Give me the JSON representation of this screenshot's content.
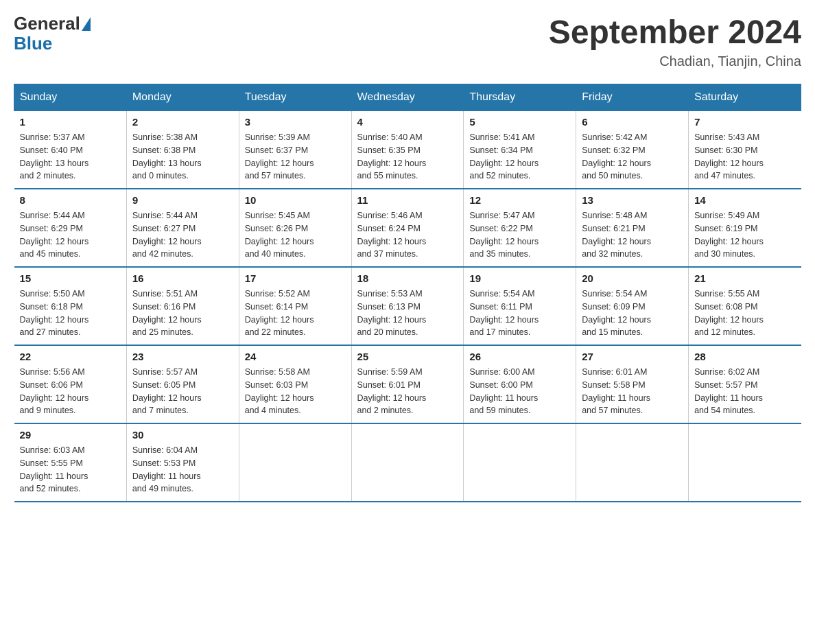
{
  "header": {
    "logo": {
      "text_general": "General",
      "text_blue": "Blue"
    },
    "title": "September 2024",
    "location": "Chadian, Tianjin, China"
  },
  "days_of_week": [
    "Sunday",
    "Monday",
    "Tuesday",
    "Wednesday",
    "Thursday",
    "Friday",
    "Saturday"
  ],
  "weeks": [
    [
      {
        "day": "1",
        "sunrise": "5:37 AM",
        "sunset": "6:40 PM",
        "daylight": "13 hours and 2 minutes."
      },
      {
        "day": "2",
        "sunrise": "5:38 AM",
        "sunset": "6:38 PM",
        "daylight": "13 hours and 0 minutes."
      },
      {
        "day": "3",
        "sunrise": "5:39 AM",
        "sunset": "6:37 PM",
        "daylight": "12 hours and 57 minutes."
      },
      {
        "day": "4",
        "sunrise": "5:40 AM",
        "sunset": "6:35 PM",
        "daylight": "12 hours and 55 minutes."
      },
      {
        "day": "5",
        "sunrise": "5:41 AM",
        "sunset": "6:34 PM",
        "daylight": "12 hours and 52 minutes."
      },
      {
        "day": "6",
        "sunrise": "5:42 AM",
        "sunset": "6:32 PM",
        "daylight": "12 hours and 50 minutes."
      },
      {
        "day": "7",
        "sunrise": "5:43 AM",
        "sunset": "6:30 PM",
        "daylight": "12 hours and 47 minutes."
      }
    ],
    [
      {
        "day": "8",
        "sunrise": "5:44 AM",
        "sunset": "6:29 PM",
        "daylight": "12 hours and 45 minutes."
      },
      {
        "day": "9",
        "sunrise": "5:44 AM",
        "sunset": "6:27 PM",
        "daylight": "12 hours and 42 minutes."
      },
      {
        "day": "10",
        "sunrise": "5:45 AM",
        "sunset": "6:26 PM",
        "daylight": "12 hours and 40 minutes."
      },
      {
        "day": "11",
        "sunrise": "5:46 AM",
        "sunset": "6:24 PM",
        "daylight": "12 hours and 37 minutes."
      },
      {
        "day": "12",
        "sunrise": "5:47 AM",
        "sunset": "6:22 PM",
        "daylight": "12 hours and 35 minutes."
      },
      {
        "day": "13",
        "sunrise": "5:48 AM",
        "sunset": "6:21 PM",
        "daylight": "12 hours and 32 minutes."
      },
      {
        "day": "14",
        "sunrise": "5:49 AM",
        "sunset": "6:19 PM",
        "daylight": "12 hours and 30 minutes."
      }
    ],
    [
      {
        "day": "15",
        "sunrise": "5:50 AM",
        "sunset": "6:18 PM",
        "daylight": "12 hours and 27 minutes."
      },
      {
        "day": "16",
        "sunrise": "5:51 AM",
        "sunset": "6:16 PM",
        "daylight": "12 hours and 25 minutes."
      },
      {
        "day": "17",
        "sunrise": "5:52 AM",
        "sunset": "6:14 PM",
        "daylight": "12 hours and 22 minutes."
      },
      {
        "day": "18",
        "sunrise": "5:53 AM",
        "sunset": "6:13 PM",
        "daylight": "12 hours and 20 minutes."
      },
      {
        "day": "19",
        "sunrise": "5:54 AM",
        "sunset": "6:11 PM",
        "daylight": "12 hours and 17 minutes."
      },
      {
        "day": "20",
        "sunrise": "5:54 AM",
        "sunset": "6:09 PM",
        "daylight": "12 hours and 15 minutes."
      },
      {
        "day": "21",
        "sunrise": "5:55 AM",
        "sunset": "6:08 PM",
        "daylight": "12 hours and 12 minutes."
      }
    ],
    [
      {
        "day": "22",
        "sunrise": "5:56 AM",
        "sunset": "6:06 PM",
        "daylight": "12 hours and 9 minutes."
      },
      {
        "day": "23",
        "sunrise": "5:57 AM",
        "sunset": "6:05 PM",
        "daylight": "12 hours and 7 minutes."
      },
      {
        "day": "24",
        "sunrise": "5:58 AM",
        "sunset": "6:03 PM",
        "daylight": "12 hours and 4 minutes."
      },
      {
        "day": "25",
        "sunrise": "5:59 AM",
        "sunset": "6:01 PM",
        "daylight": "12 hours and 2 minutes."
      },
      {
        "day": "26",
        "sunrise": "6:00 AM",
        "sunset": "6:00 PM",
        "daylight": "11 hours and 59 minutes."
      },
      {
        "day": "27",
        "sunrise": "6:01 AM",
        "sunset": "5:58 PM",
        "daylight": "11 hours and 57 minutes."
      },
      {
        "day": "28",
        "sunrise": "6:02 AM",
        "sunset": "5:57 PM",
        "daylight": "11 hours and 54 minutes."
      }
    ],
    [
      {
        "day": "29",
        "sunrise": "6:03 AM",
        "sunset": "5:55 PM",
        "daylight": "11 hours and 52 minutes."
      },
      {
        "day": "30",
        "sunrise": "6:04 AM",
        "sunset": "5:53 PM",
        "daylight": "11 hours and 49 minutes."
      },
      null,
      null,
      null,
      null,
      null
    ]
  ]
}
